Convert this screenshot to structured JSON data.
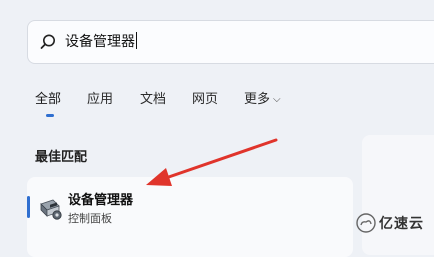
{
  "search": {
    "query": "设备管理器"
  },
  "tabs": [
    {
      "label": "全部",
      "active": true
    },
    {
      "label": "应用"
    },
    {
      "label": "文档"
    },
    {
      "label": "网页"
    },
    {
      "label": "更多"
    }
  ],
  "section": {
    "title": "最佳匹配"
  },
  "best_match": {
    "name": "设备管理器",
    "subtitle": "控制面板",
    "icon": "device-manager-icon"
  },
  "annotation": {
    "color": "#e0342b"
  },
  "watermark": {
    "text": "亿速云"
  },
  "colors": {
    "accent": "#2f6fd0",
    "background": "#eef1f6"
  }
}
